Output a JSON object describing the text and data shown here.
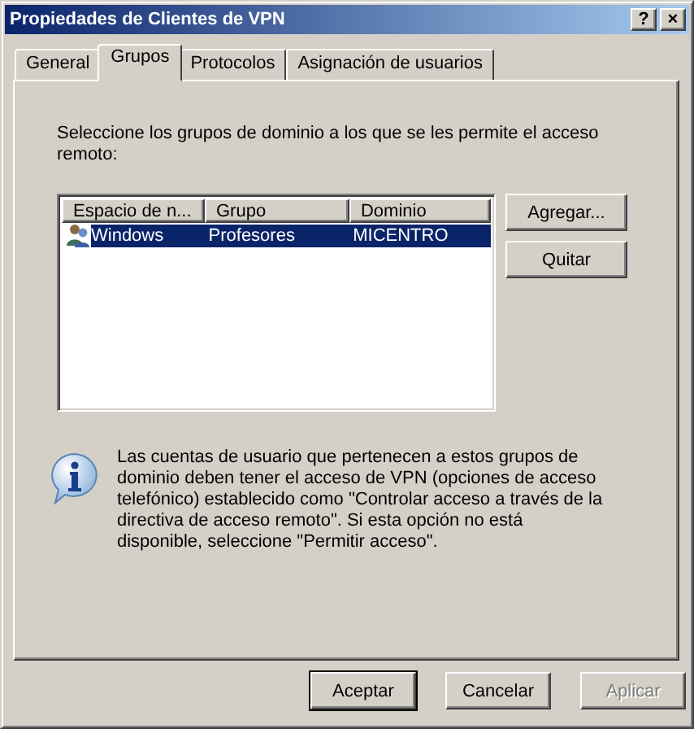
{
  "window": {
    "title": "Propiedades de Clientes de VPN",
    "title_buttons": [
      "?",
      "×"
    ]
  },
  "tabs": [
    {
      "label": "General",
      "selected": false
    },
    {
      "label": "Grupos",
      "selected": true
    },
    {
      "label": "Protocolos",
      "selected": false
    },
    {
      "label": "Asignación de usuarios",
      "selected": false
    }
  ],
  "instruction": "Seleccione los grupos de dominio a los que se les permite el acceso remoto:",
  "table": {
    "columns": [
      "Espacio de n...",
      "Grupo",
      "Dominio"
    ],
    "rows": [
      {
        "cells": [
          "Windows",
          "Profesores",
          "MICENTRO"
        ],
        "selected": true
      }
    ]
  },
  "side_buttons": [
    {
      "label": "Agregar..."
    },
    {
      "label": "Quitar"
    }
  ],
  "info": "Las cuentas de usuario que pertenecen a estos grupos de dominio deben tener el acceso de VPN (opciones de acceso telefónico) establecido como \"Controlar acceso a través de la directiva de acceso remoto\". Si esta opción no está disponible, seleccione \"Permitir acceso\".",
  "buttons": [
    {
      "label": "Aceptar",
      "disabled": false,
      "default": true
    },
    {
      "label": "Cancelar",
      "disabled": false,
      "default": false
    },
    {
      "label": "Aplicar",
      "disabled": true,
      "default": false
    }
  ]
}
